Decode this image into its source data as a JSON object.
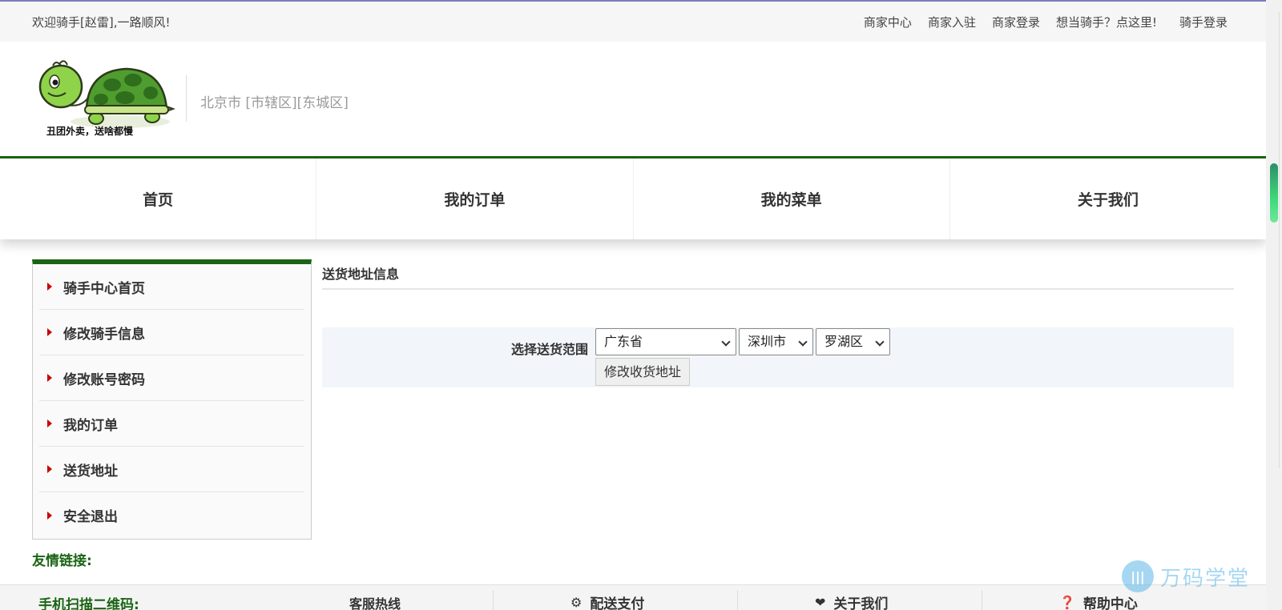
{
  "topbar": {
    "welcome": "欢迎骑手[赵雷],一路顺风!",
    "links": [
      "商家中心",
      "商家入驻",
      "商家登录",
      "想当骑手？点这里!",
      "骑手登录"
    ]
  },
  "header": {
    "logo_text": "丑团外卖，送啥都慢",
    "city": "北京市 [市辖区][东城区]"
  },
  "nav": {
    "items": [
      "首页",
      "我的订单",
      "我的菜单",
      "关于我们"
    ]
  },
  "sidebar": {
    "items": [
      "骑手中心首页",
      "修改骑手信息",
      "修改账号密码",
      "我的订单",
      "送货地址",
      "安全退出"
    ]
  },
  "friend_links_label": "友情链接:",
  "content": {
    "title": "送货地址信息",
    "range_label": "选择送货范围",
    "province": "广东省",
    "city": "深圳市",
    "district": "罗湖区",
    "submit_label": "修改收货地址"
  },
  "footer": {
    "qr_label": "手机扫描二维码:",
    "hotline_label": "客服热线",
    "columns": [
      {
        "icon": "bike-icon",
        "label": "配送支付"
      },
      {
        "icon": "heart-icon",
        "label": "关于我们"
      },
      {
        "icon": "help-icon",
        "label": "帮助中心"
      }
    ]
  },
  "watermark": "万码学堂",
  "colors": {
    "brand_green": "#1a6414",
    "arrow_red": "#cc0000"
  }
}
